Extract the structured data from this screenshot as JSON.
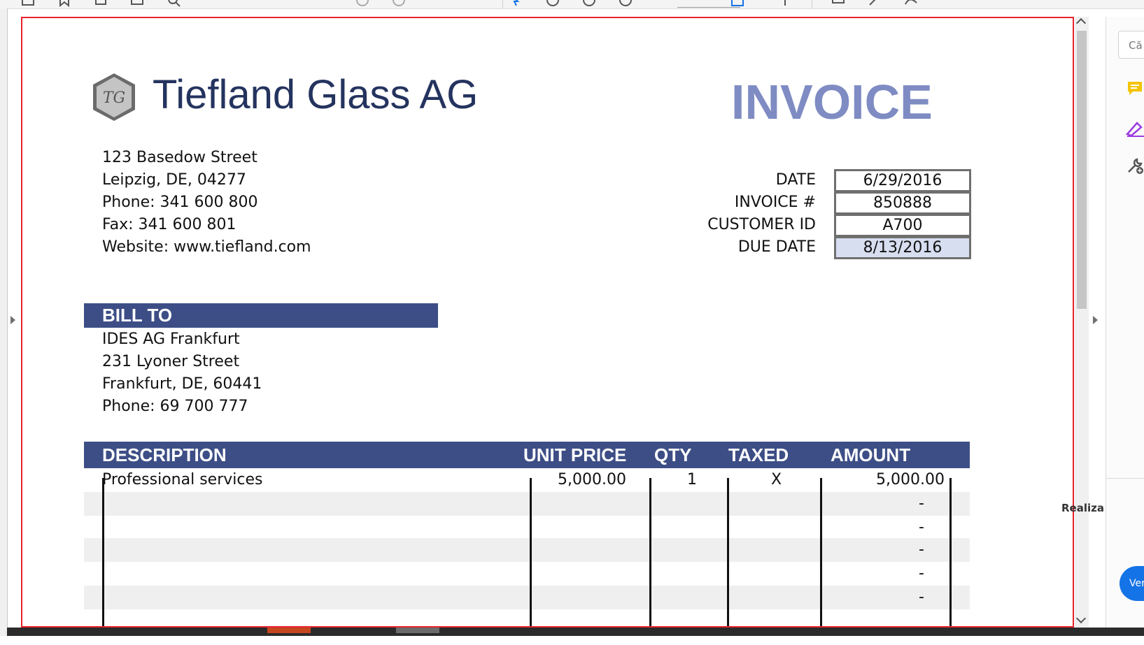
{
  "colors": {
    "accent": "#3d4e86",
    "title": "#7f8cc3",
    "company": "#24335e",
    "focus_frame": "#e8232c",
    "highlight": "#d7def0"
  },
  "toolbar": {
    "icons": [
      "sidebar-icon",
      "bookmark-icon",
      "print-icon",
      "mail-icon",
      "search-icon",
      "prev-page-icon",
      "next-page-icon",
      "select-tool-icon",
      "zoom-out-icon",
      "zoom-in-icon",
      "fit-page-icon",
      "scroll-icon",
      "comment-icon",
      "highlight-icon",
      "sign-icon"
    ]
  },
  "right_panel": {
    "search_placeholder": "Că",
    "tools_label": "Realiza",
    "button_label": "Vers"
  },
  "invoice": {
    "company_name": "Tiefland Glass AG",
    "title": "INVOICE",
    "address_lines": [
      "123 Basedow Street",
      "Leipzig, DE, 04277",
      "Phone: 341 600 800",
      "Fax: 341 600 801",
      "Website: www.tiefland.com"
    ],
    "meta": [
      {
        "label": "DATE",
        "value": "6/29/2016"
      },
      {
        "label": "INVOICE #",
        "value": "850888"
      },
      {
        "label": "CUSTOMER ID",
        "value": "A700"
      },
      {
        "label": "DUE DATE",
        "value": "8/13/2016"
      }
    ],
    "bill_to": {
      "heading": "BILL TO",
      "lines": [
        "IDES AG Frankfurt",
        "231 Lyoner Street",
        "Frankfurt, DE, 60441",
        "Phone: 69 700 777"
      ]
    },
    "table": {
      "headers": [
        "DESCRIPTION",
        "UNIT PRICE",
        "QTY",
        "TAXED",
        "AMOUNT"
      ],
      "rows": [
        {
          "description": "Professional services",
          "unit_price": "5,000.00",
          "qty": "1",
          "taxed": "X",
          "amount": "5,000.00"
        },
        {
          "description": "",
          "unit_price": "",
          "qty": "",
          "taxed": "",
          "amount": "-"
        },
        {
          "description": "",
          "unit_price": "",
          "qty": "",
          "taxed": "",
          "amount": "-"
        },
        {
          "description": "",
          "unit_price": "",
          "qty": "",
          "taxed": "",
          "amount": "-"
        },
        {
          "description": "",
          "unit_price": "",
          "qty": "",
          "taxed": "",
          "amount": "-"
        },
        {
          "description": "",
          "unit_price": "",
          "qty": "",
          "taxed": "",
          "amount": "-"
        }
      ]
    }
  }
}
